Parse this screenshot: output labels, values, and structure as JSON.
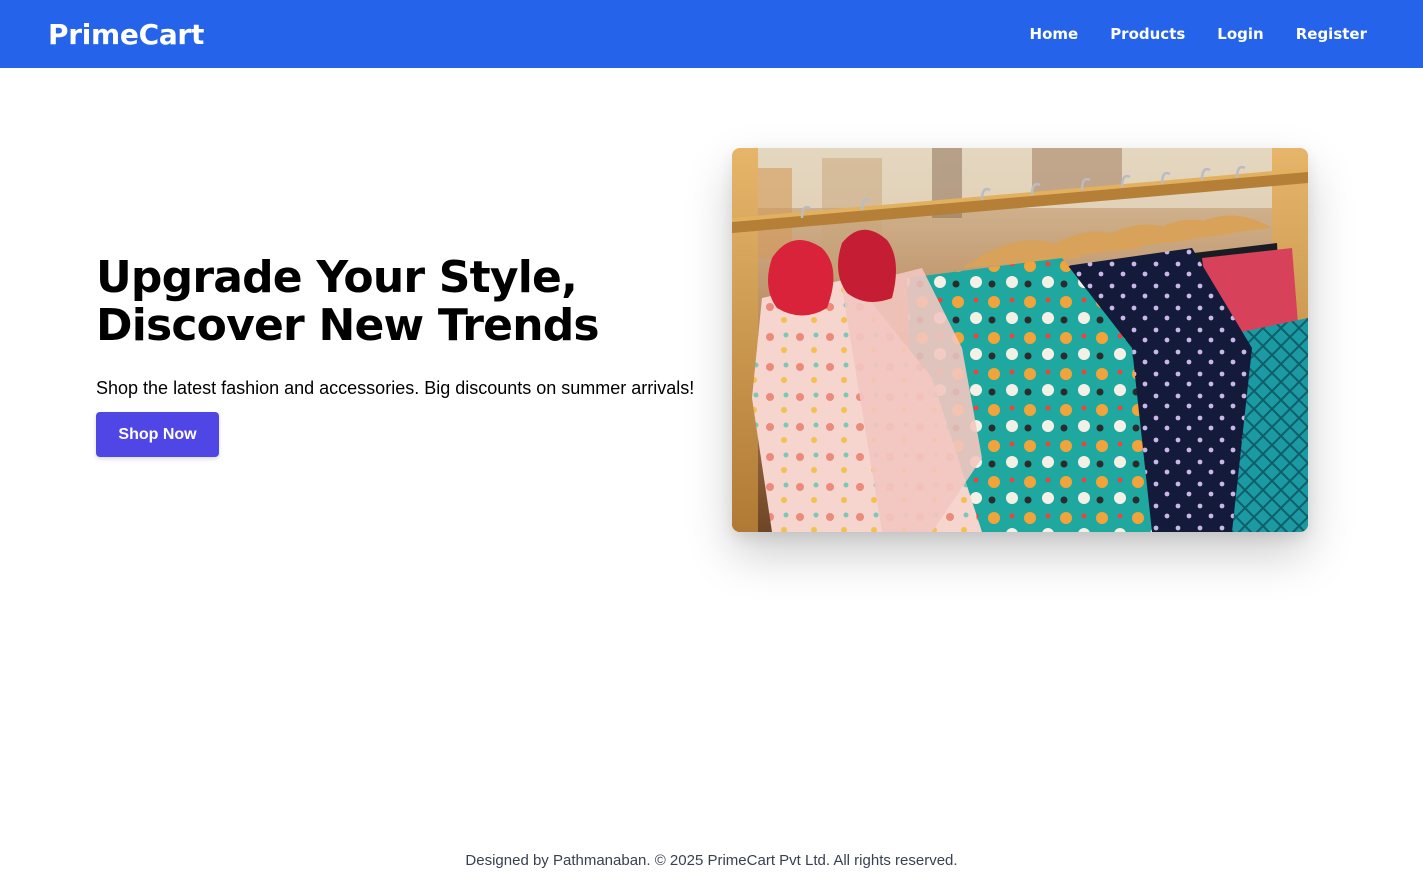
{
  "header": {
    "brand": "PrimeCart",
    "nav": [
      {
        "label": "Home"
      },
      {
        "label": "Products"
      },
      {
        "label": "Login"
      },
      {
        "label": "Register"
      }
    ]
  },
  "hero": {
    "title_line1": "Upgrade Your Style,",
    "title_line2": "Discover New Trends",
    "subtitle": "Shop the latest fashion and accessories. Big discounts on summer arrivals!",
    "cta_label": "Shop Now"
  },
  "footer": {
    "text": "Designed by Pathmanaban. © 2025 PrimeCart Pvt Ltd. All rights reserved."
  },
  "colors": {
    "header_bg": "#2563eb",
    "cta_bg": "#4f46e5",
    "footer_text": "#374151"
  }
}
